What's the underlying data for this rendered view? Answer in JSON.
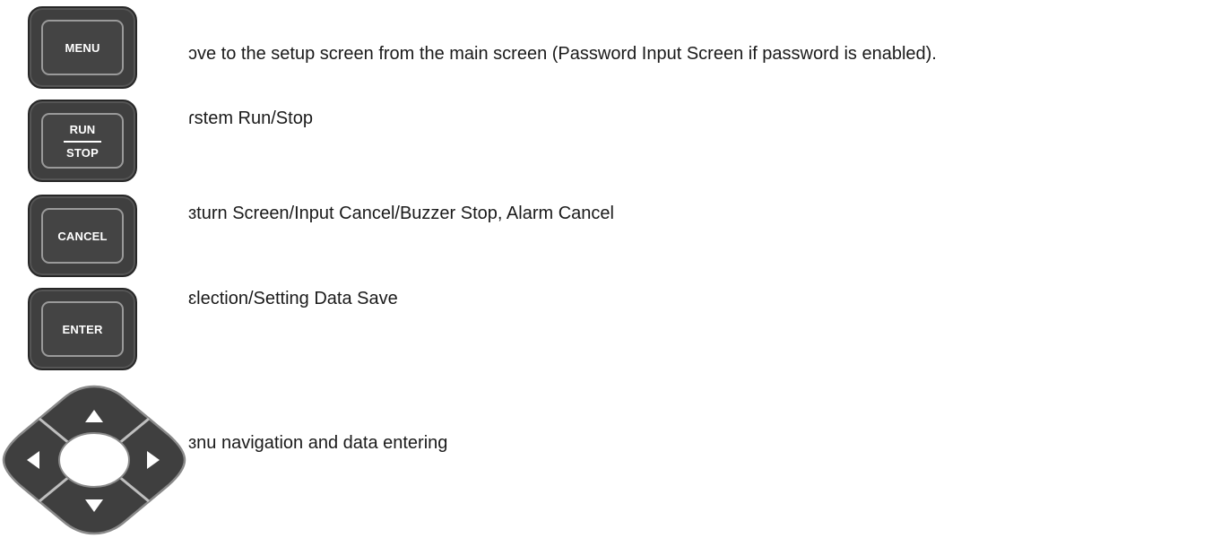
{
  "keys": {
    "menu": {
      "label": "MENU",
      "description": "ɔve to the setup screen from the main screen (Password Input Screen if password is enabled)."
    },
    "run_stop": {
      "label_top": "RUN",
      "label_bottom": "STOP",
      "description": "ɾstem Run/Stop"
    },
    "cancel": {
      "label": "CANCEL",
      "description": "ɜturn Screen/Input Cancel/Buzzer Stop, Alarm Cancel"
    },
    "enter": {
      "label": "ENTER",
      "description": "ɛlection/Setting Data Save"
    },
    "arrows": {
      "description": "ɜnu navigation and data entering"
    }
  },
  "colors": {
    "key_body": "#3f3f3f",
    "key_rim": "#9a9a9a",
    "key_text": "#ffffff",
    "text": "#1a1a1a"
  }
}
